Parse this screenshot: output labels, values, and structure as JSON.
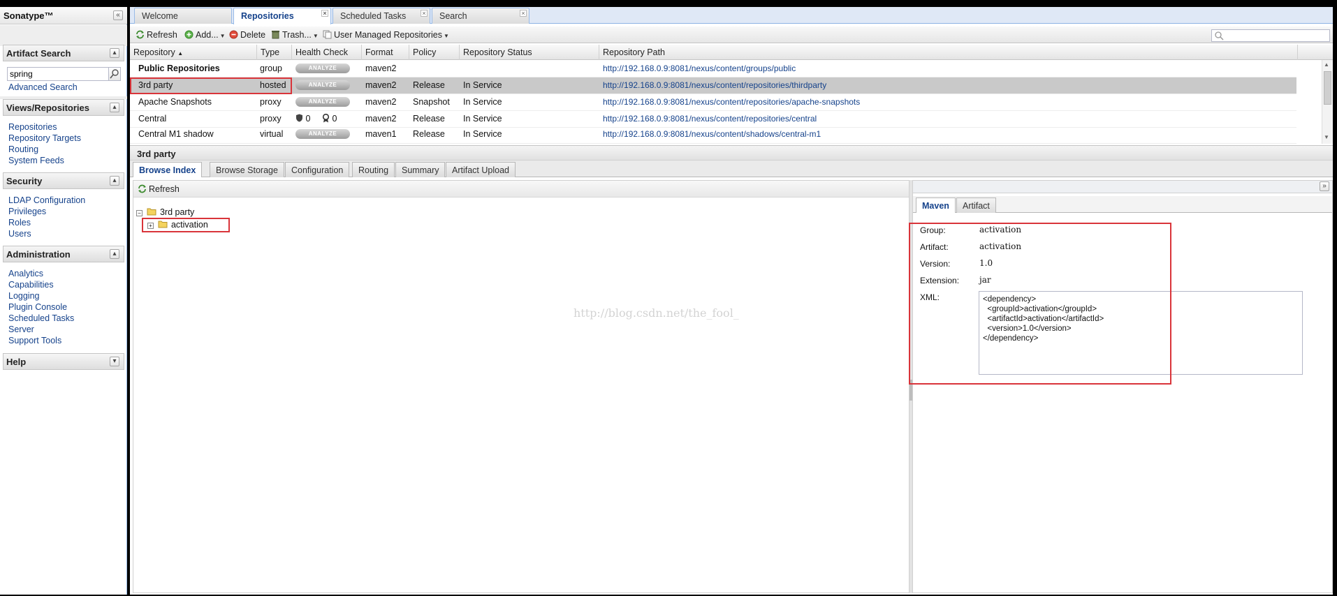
{
  "brand": {
    "title": "Sonatype™"
  },
  "artifact_search": {
    "title": "Artifact Search",
    "query_value": "spring",
    "advanced_link": "Advanced Search"
  },
  "views_repositories": {
    "title": "Views/Repositories",
    "items": [
      "Repositories",
      "Repository Targets",
      "Routing",
      "System Feeds"
    ]
  },
  "security": {
    "title": "Security",
    "items": [
      "LDAP Configuration",
      "Privileges",
      "Roles",
      "Users"
    ]
  },
  "administration": {
    "title": "Administration",
    "items": [
      "Analytics",
      "Capabilities",
      "Logging",
      "Plugin Console",
      "Scheduled Tasks",
      "Server",
      "Support Tools"
    ]
  },
  "help": {
    "title": "Help"
  },
  "main_tabs": [
    {
      "label": "Welcome",
      "active": false
    },
    {
      "label": "Repositories",
      "active": true
    },
    {
      "label": "Scheduled Tasks",
      "active": false
    },
    {
      "label": "Search",
      "active": false
    }
  ],
  "toolbar": {
    "refresh": "Refresh",
    "add": "Add...",
    "delete": "Delete",
    "trash": "Trash...",
    "user_managed": "User Managed Repositories"
  },
  "grid": {
    "columns": [
      "Repository",
      "Type",
      "Health Check",
      "Format",
      "Policy",
      "Repository Status",
      "Repository Path"
    ],
    "analyze_label": "ANALYZE",
    "rows": [
      {
        "name": "Public Repositories",
        "type": "group",
        "health": "analyze",
        "format": "maven2",
        "policy": "",
        "status": "",
        "path": "http://192.168.0.9:8081/nexus/content/groups/public",
        "bold": true
      },
      {
        "name": "3rd party",
        "type": "hosted",
        "health": "analyze",
        "format": "maven2",
        "policy": "Release",
        "status": "In Service",
        "path": "http://192.168.0.9:8081/nexus/content/repositories/thirdparty",
        "selected": true
      },
      {
        "name": "Apache Snapshots",
        "type": "proxy",
        "health": "analyze",
        "format": "maven2",
        "policy": "Snapshot",
        "status": "In Service",
        "path": "http://192.168.0.9:8081/nexus/content/repositories/apache-snapshots"
      },
      {
        "name": "Central",
        "type": "proxy",
        "health": "counts",
        "security_count": "0",
        "license_count": "0",
        "format": "maven2",
        "policy": "Release",
        "status": "In Service",
        "path": "http://192.168.0.9:8081/nexus/content/repositories/central"
      },
      {
        "name": "Central M1 shadow",
        "type": "virtual",
        "health": "analyze",
        "format": "maven1",
        "policy": "Release",
        "status": "In Service",
        "path": "http://192.168.0.9:8081/nexus/content/shadows/central-m1"
      }
    ]
  },
  "detail": {
    "title": "3rd party",
    "tabs": [
      "Browse Index",
      "Browse Storage",
      "Configuration",
      "Routing",
      "Summary",
      "Artifact Upload"
    ],
    "refresh": "Refresh",
    "tree_root": "3rd party",
    "tree_child": "activation",
    "watermark": "http://blog.csdn.net/the_fool_"
  },
  "maven": {
    "tabs": [
      "Maven",
      "Artifact"
    ],
    "group_label": "Group:",
    "group": "activation",
    "artifact_label": "Artifact:",
    "artifact": "activation",
    "version_label": "Version:",
    "version": "1.0",
    "extension_label": "Extension:",
    "extension": "jar",
    "xml_label": "XML:",
    "xml": "<dependency>\n  <groupId>activation</groupId>\n  <artifactId>activation</artifactId>\n  <version>1.0</version>\n</dependency>"
  },
  "colors": {
    "link": "#15428b",
    "highlight": "#d9343a",
    "selected_row": "#c9c9c9"
  }
}
